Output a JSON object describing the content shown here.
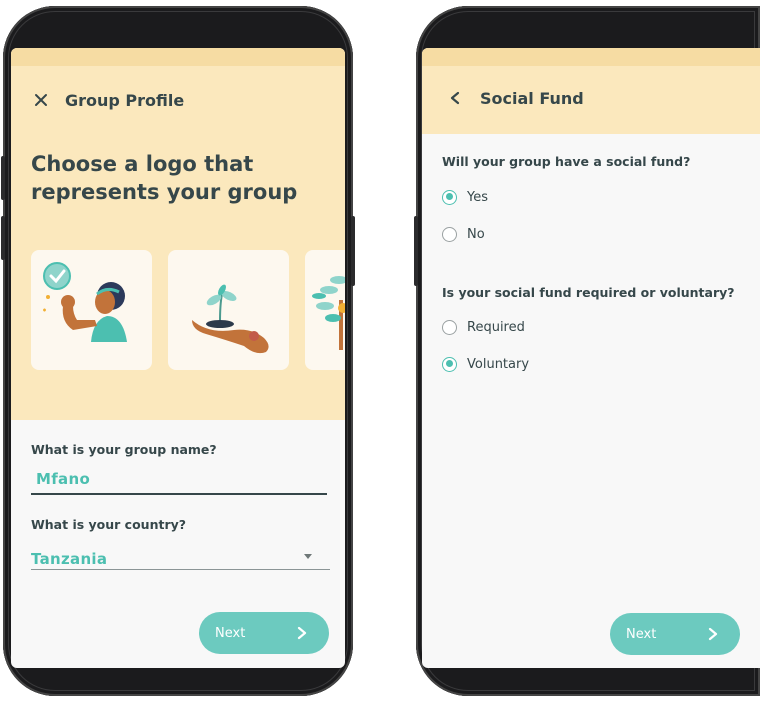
{
  "group_profile": {
    "close_icon": "close-icon",
    "title": "Group Profile",
    "headline": "Choose a logo that represents your group",
    "logo_options": [
      {
        "icon": "flexing-woman-check-icon"
      },
      {
        "icon": "hand-with-sprout-icon"
      },
      {
        "icon": "tree-icon"
      }
    ],
    "group_name": {
      "label": "What is your group name?",
      "value": "Mfano"
    },
    "country": {
      "label": "What is your country?",
      "value": "Tanzania"
    },
    "next_label": "Next"
  },
  "social_fund": {
    "back_icon": "chevron-left-icon",
    "title": "Social Fund",
    "questions": [
      {
        "label": "Will your group have a social fund?",
        "options": [
          "Yes",
          "No"
        ],
        "selected": "Yes"
      },
      {
        "label": "Is your social fund required or voluntary?",
        "options": [
          "Required",
          "Voluntary"
        ],
        "selected": "Voluntary"
      }
    ],
    "next_label": "Next"
  },
  "colors": {
    "accent": "#4cbfb0",
    "button": "#6ccabf",
    "header": "#fbe8bd",
    "text": "#36474a"
  }
}
